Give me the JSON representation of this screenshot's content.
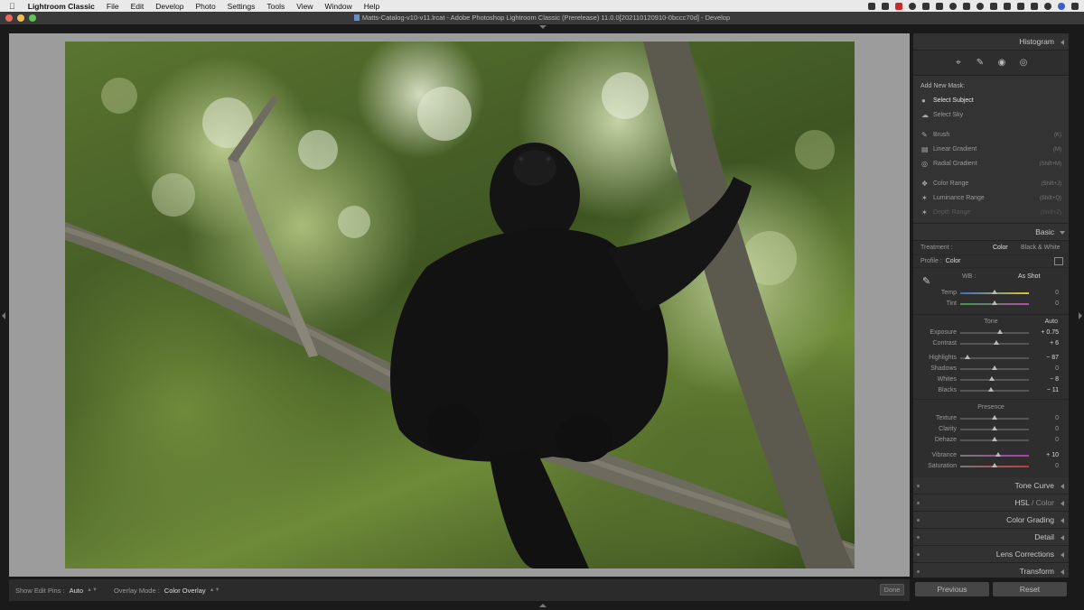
{
  "menubar": {
    "app_name": "Lightroom Classic",
    "items": [
      "File",
      "Edit",
      "Develop",
      "Photo",
      "Settings",
      "Tools",
      "View",
      "Window",
      "Help"
    ]
  },
  "window": {
    "title": "Matts-Catalog-v10-v11.lrcat - Adobe Photoshop Lightroom Classic (Prerelease) 11.0.0[202110120910-0bccc70d] - Develop"
  },
  "toolbar": {
    "edit_pins_label": "Show Edit Pins :",
    "edit_pins_value": "Auto",
    "overlay_label": "Overlay Mode :",
    "overlay_value": "Color Overlay",
    "done_label": "Done"
  },
  "panel": {
    "histogram_label": "Histogram",
    "tools": [
      "crop-icon",
      "heal-icon",
      "redeye-icon",
      "mask-icon"
    ],
    "mask": {
      "title": "Add New Mask:",
      "items": [
        {
          "label": "Select Subject",
          "key": "",
          "state": "hl",
          "icon": "person-icon"
        },
        {
          "label": "Select Sky",
          "key": "",
          "state": "normal",
          "icon": "sky-icon"
        },
        {
          "label": "Brush",
          "key": "(K)",
          "state": "normal",
          "icon": "brush-icon"
        },
        {
          "label": "Linear Gradient",
          "key": "(M)",
          "state": "normal",
          "icon": "linear-gradient-icon"
        },
        {
          "label": "Radial Gradient",
          "key": "(Shift+M)",
          "state": "normal",
          "icon": "radial-gradient-icon"
        },
        {
          "label": "Color Range",
          "key": "(Shift+J)",
          "state": "normal",
          "icon": "color-range-icon"
        },
        {
          "label": "Luminance Range",
          "key": "(Shift+Q)",
          "state": "normal",
          "icon": "luminance-range-icon"
        },
        {
          "label": "Depth Range",
          "key": "(Shift+Z)",
          "state": "dim",
          "icon": "depth-range-icon"
        }
      ]
    },
    "basic": {
      "header": "Basic",
      "treatment_label": "Treatment :",
      "treatment_color": "Color",
      "treatment_bw": "Black & White",
      "profile_label": "Profile :",
      "profile_value": "Color",
      "wb_label": "WB :",
      "wb_value": "As Shot",
      "tone_label": "Tone",
      "auto_label": "Auto",
      "presence_label": "Presence",
      "wb_sliders": [
        {
          "label": "Temp",
          "value": "0",
          "pos": 0.5
        },
        {
          "label": "Tint",
          "value": "0",
          "pos": 0.5
        }
      ],
      "tone_sliders": [
        {
          "label": "Exposure",
          "value": "+ 0.75",
          "pos": 0.58,
          "active": true
        },
        {
          "label": "Contrast",
          "value": "+ 6",
          "pos": 0.53,
          "active": true
        }
      ],
      "tone_sliders2": [
        {
          "label": "Highlights",
          "value": "− 87",
          "pos": 0.1,
          "active": true
        },
        {
          "label": "Shadows",
          "value": "0",
          "pos": 0.5,
          "active": false
        },
        {
          "label": "Whites",
          "value": "− 8",
          "pos": 0.46,
          "active": true
        },
        {
          "label": "Blacks",
          "value": "− 11",
          "pos": 0.45,
          "active": true
        }
      ],
      "presence_sliders": [
        {
          "label": "Texture",
          "value": "0",
          "pos": 0.5,
          "active": false
        },
        {
          "label": "Clarity",
          "value": "0",
          "pos": 0.5,
          "active": false
        },
        {
          "label": "Dehaze",
          "value": "0",
          "pos": 0.5,
          "active": false
        }
      ],
      "presence_sliders2": [
        {
          "label": "Vibrance",
          "value": "+ 10",
          "pos": 0.55,
          "active": true
        },
        {
          "label": "Saturation",
          "value": "0",
          "pos": 0.5,
          "active": false
        }
      ]
    },
    "tone_curve": "Tone Curve",
    "hsl": "HSL",
    "hsl_sep": " / ",
    "hsl_color": "Color",
    "color_grading": "Color Grading",
    "detail": "Detail",
    "lens": "Lens Corrections",
    "transform": "Transform"
  },
  "buttons": {
    "previous": "Previous",
    "reset": "Reset"
  }
}
